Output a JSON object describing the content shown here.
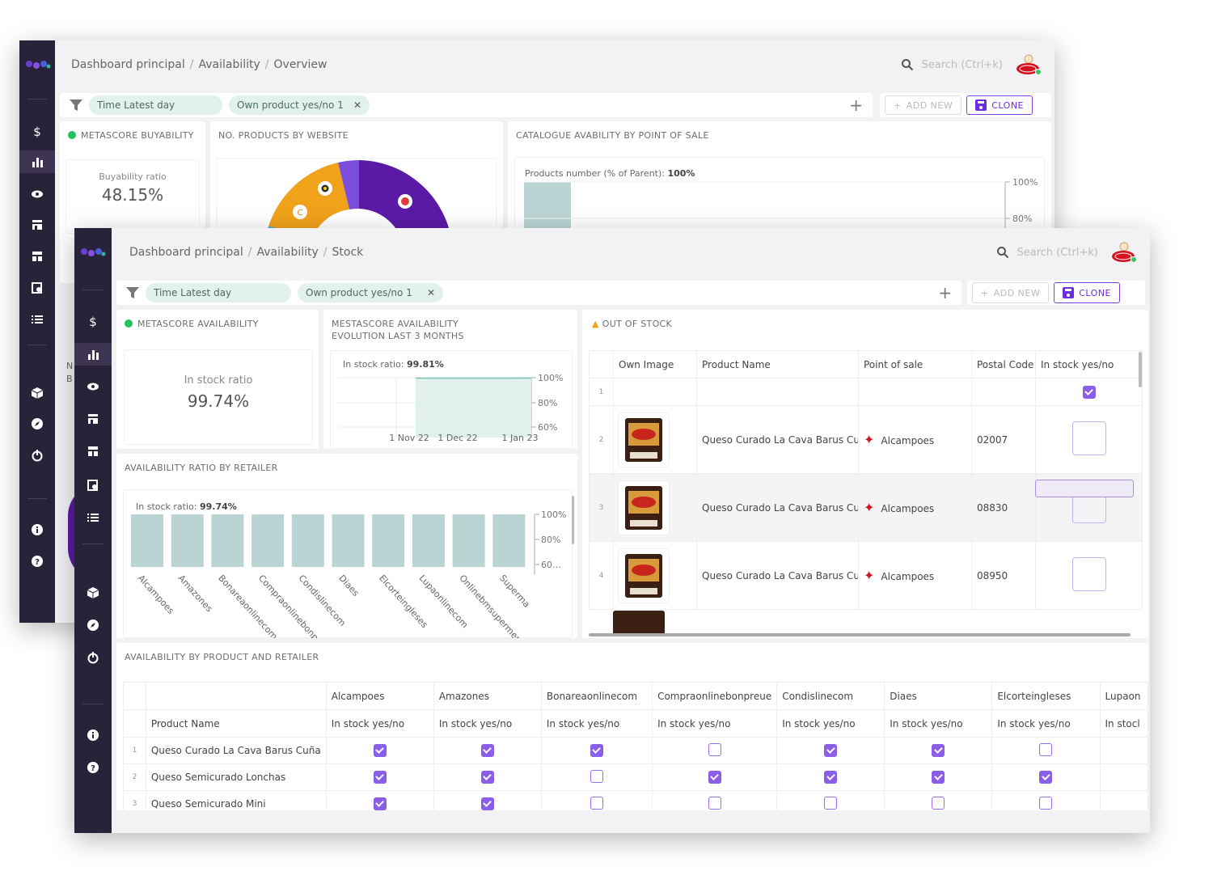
{
  "colors": {
    "rail": "#292339",
    "accent": "#7b3fe4",
    "bar": "#b9d4d2",
    "donut_purple": "#5b1aa6",
    "donut_orange": "#f0a21b"
  },
  "back_window": {
    "breadcrumb": [
      "Dashboard principal",
      "Availability",
      "Overview"
    ],
    "search_placeholder": "Search (Ctrl+k)",
    "filters": {
      "time": "Time Latest day",
      "own_product": "Own product yes/no 1"
    },
    "buttons": {
      "add_new": "ADD NEW",
      "clone": "CLONE"
    },
    "metascore": {
      "title": "METASCORE BUYABILITY",
      "label": "Buyability ratio",
      "value": "48.15%"
    },
    "donut": {
      "title": "NO. PRODUCTS BY WEBSITE"
    },
    "catalogue": {
      "title": "CATALOGUE AVABILITY BY POINT OF SALE",
      "caption_label": "Products number (% of Parent): ",
      "caption_value": "100%",
      "ticks": [
        "100%",
        "80%"
      ]
    },
    "clipped_label": "N\nB"
  },
  "front_window": {
    "breadcrumb": [
      "Dashboard principal",
      "Availability",
      "Stock"
    ],
    "search_placeholder": "Search (Ctrl+k)",
    "filters": {
      "time": "Time Latest day",
      "own_product": "Own product yes/no 1"
    },
    "buttons": {
      "add_new": "ADD NEW",
      "clone": "CLONE"
    },
    "metascore": {
      "title": "METASCORE AVAILABILITY",
      "label": "In stock ratio",
      "value": "99.74%"
    },
    "evolution": {
      "title_line1": "MESTASCORE AVAILABILITY",
      "title_line2": "EVOLUTION LAST 3 MONTHS",
      "caption_label": "In stock ratio: ",
      "caption_value": "99.81%",
      "x_ticks": [
        "1 Nov 22",
        "1 Dec 22",
        "1 Jan 23"
      ],
      "y_ticks": [
        "100%",
        "80%",
        "60%"
      ]
    },
    "retailer_chart": {
      "title": "AVAILABILITY RATIO BY RETAILER",
      "caption_label": "In stock ratio: ",
      "caption_value": "99.74%",
      "y_ticks": [
        "100%",
        "80%",
        "60%"
      ]
    },
    "out_of_stock": {
      "title": "OUT OF STOCK",
      "headers": [
        "Own Image",
        "Product Name",
        "Point of sale",
        "Postal Code",
        "In stock yes/no"
      ],
      "rows": [
        {
          "n": "1",
          "product": "",
          "pos": "",
          "postal": "",
          "checked": true,
          "image": false
        },
        {
          "n": "2",
          "product": "Queso Curado La Cava Barus Cuña",
          "pos": "Alcampoes",
          "postal": "02007",
          "checked": false,
          "image": true
        },
        {
          "n": "3",
          "product": "Queso Curado La Cava Barus Cuña",
          "pos": "Alcampoes",
          "postal": "08830",
          "checked": false,
          "image": true
        },
        {
          "n": "4",
          "product": "Queso Curado La Cava Barus Cuña",
          "pos": "Alcampoes",
          "postal": "08950",
          "checked": false,
          "image": true
        }
      ]
    },
    "matrix": {
      "title": "AVAILABILITY BY PRODUCT AND RETAILER",
      "product_header": "Product Name",
      "sub_header": "In stock yes/no",
      "sub_header_clipped": "In stocl",
      "retailers": [
        "Alcampoes",
        "Amazones",
        "Bonareaonlinecom",
        "Compraonlinebonpreue",
        "Condislinecom",
        "Diaes",
        "Elcorteingleses",
        "Lupaon"
      ],
      "rows": [
        {
          "n": "1",
          "name": "Queso Curado La Cava Barus Cuña",
          "stock": [
            true,
            true,
            true,
            false,
            true,
            true,
            false
          ]
        },
        {
          "n": "2",
          "name": "Queso Semicurado Lonchas",
          "stock": [
            true,
            true,
            false,
            true,
            true,
            true,
            true
          ]
        },
        {
          "n": "3",
          "name": "Queso Semicurado Mini",
          "stock": [
            true,
            true,
            false,
            false,
            false,
            false,
            false
          ]
        }
      ]
    }
  },
  "chart_data": [
    {
      "type": "line",
      "title": "MESTASCORE AVAILABILITY EVOLUTION LAST 3 MONTHS",
      "x": [
        "1 Nov 22",
        "1 Dec 22",
        "1 Jan 23"
      ],
      "series": [
        {
          "name": "In stock ratio",
          "values": [
            99.8,
            99.8,
            99.81
          ]
        }
      ],
      "ylim": [
        60,
        100
      ]
    },
    {
      "type": "bar",
      "title": "AVAILABILITY RATIO BY RETAILER",
      "categories": [
        "Alcampoes",
        "Amazones",
        "Bonareaonlinecom",
        "Compraonlinebonpre",
        "Condislinecom",
        "Diaes",
        "Elcorteingleses",
        "Lupaonlinecom",
        "Onlinebmsupermerc",
        "Superma"
      ],
      "values": [
        100,
        100,
        100,
        100,
        100,
        100,
        100,
        100,
        100,
        100
      ],
      "ylim": [
        60,
        100
      ]
    },
    {
      "type": "bar",
      "title": "CATALOGUE AVABILITY BY POINT OF SALE",
      "categories": [
        ""
      ],
      "values": [
        100
      ],
      "ylim": [
        80,
        100
      ]
    }
  ]
}
